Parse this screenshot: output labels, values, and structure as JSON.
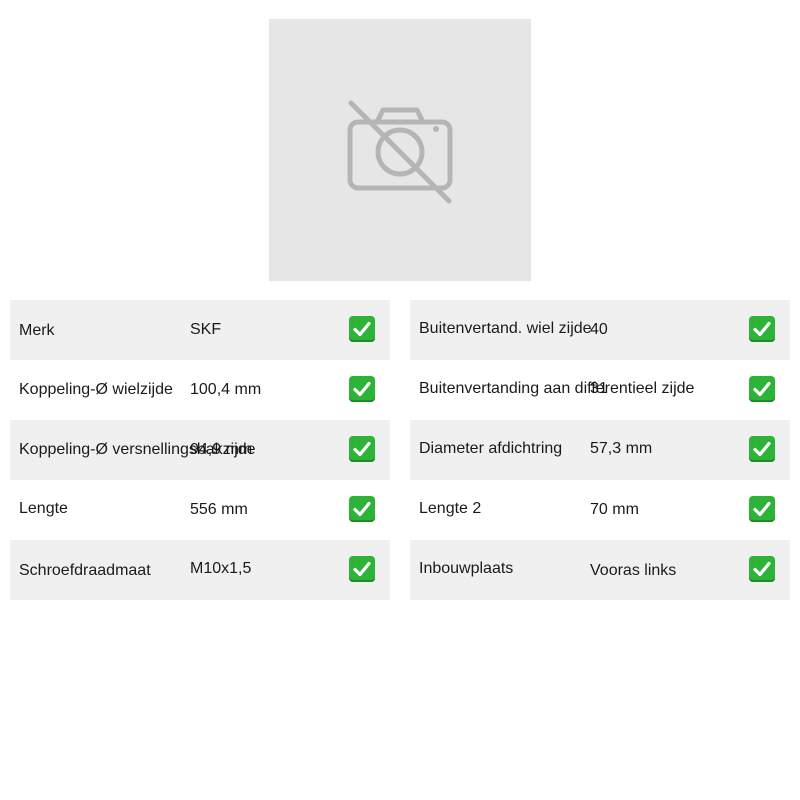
{
  "image": {
    "icon": "no-photo-icon",
    "background": "#e6e6e6"
  },
  "specs": {
    "left": [
      {
        "label": "Merk",
        "value": "SKF",
        "checked": true
      },
      {
        "label": "Koppeling-Ø wielzijde",
        "value": "100,4 mm",
        "checked": true
      },
      {
        "label": "Koppeling-Ø versnellingsbakzijde",
        "value": "94,9 mm",
        "checked": true
      },
      {
        "label": "Lengte",
        "value": "556 mm",
        "checked": true
      },
      {
        "label": "Schroefdraadmaat",
        "value": "M10x1,5",
        "checked": true
      }
    ],
    "right": [
      {
        "label": "Buitenvertand. wiel zijde",
        "value": "40",
        "checked": true
      },
      {
        "label": "Buitenvertanding aan differentieel zijde",
        "value": "31",
        "checked": true
      },
      {
        "label": "Diameter afdichtring",
        "value": "57,3 mm",
        "checked": true
      },
      {
        "label": "Lengte 2",
        "value": "70 mm",
        "checked": true
      },
      {
        "label": "Inbouwplaats",
        "value": "Vooras links",
        "checked": true
      }
    ]
  },
  "colors": {
    "row_shade": "#f0f0f0",
    "check": "#2db337"
  }
}
